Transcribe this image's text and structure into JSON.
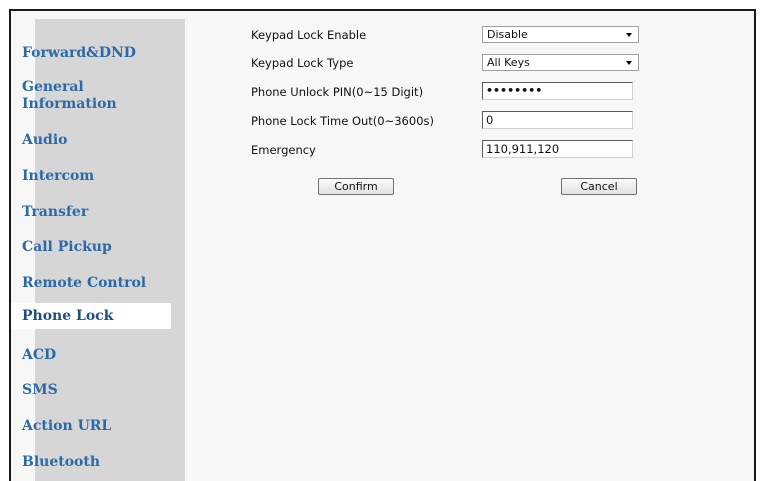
{
  "sidebar": {
    "items": [
      {
        "label": "Forward&DND"
      },
      {
        "label": "General Information"
      },
      {
        "label": "Audio"
      },
      {
        "label": "Intercom"
      },
      {
        "label": "Transfer"
      },
      {
        "label": "Call Pickup"
      },
      {
        "label": "Remote Control"
      },
      {
        "label": "Phone Lock",
        "active": true
      },
      {
        "label": "ACD"
      },
      {
        "label": "SMS"
      },
      {
        "label": "Action URL"
      },
      {
        "label": "Bluetooth"
      }
    ]
  },
  "form": {
    "keypad_lock_enable": {
      "label": "Keypad Lock Enable",
      "value": "Disable"
    },
    "keypad_lock_type": {
      "label": "Keypad Lock Type",
      "value": "All Keys"
    },
    "unlock_pin": {
      "label": "Phone Unlock PIN(0~15 Digit)",
      "value": "••••••••"
    },
    "lock_timeout": {
      "label": "Phone Lock Time Out(0~3600s)",
      "value": "0"
    },
    "emergency": {
      "label": "Emergency",
      "value": "110,911,120"
    }
  },
  "buttons": {
    "confirm_label": "Confirm",
    "cancel_label": "Cancel"
  },
  "colors": {
    "sidebar_bg": "#d6d6d6",
    "sidebar_text": "#2b6aa8",
    "active_bg": "#ffffff",
    "content_bg": "#f7f7f7"
  }
}
